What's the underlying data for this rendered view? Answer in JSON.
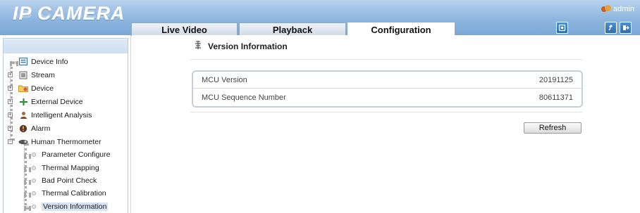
{
  "app": {
    "logo": "IP CAMERA",
    "user": "admin"
  },
  "tabs": [
    {
      "label": "Live Video",
      "active": false
    },
    {
      "label": "Playback",
      "active": false
    },
    {
      "label": "Configuration",
      "active": true
    }
  ],
  "header_icons": [
    "alarm-bell-icon",
    "change-password-icon",
    "logout-icon"
  ],
  "sidebar": {
    "items": [
      {
        "label": "Device Info",
        "icon": "device-info-icon"
      },
      {
        "label": "Stream",
        "icon": "stream-icon"
      },
      {
        "label": "Device",
        "icon": "device-folder-icon"
      },
      {
        "label": "External Device",
        "icon": "external-device-icon"
      },
      {
        "label": "Intelligent Analysis",
        "icon": "intelligent-analysis-icon"
      },
      {
        "label": "Alarm",
        "icon": "alarm-icon"
      },
      {
        "label": "Human Thermometer",
        "icon": "thermometer-icon"
      }
    ],
    "sub_items": [
      {
        "label": "Parameter Configure"
      },
      {
        "label": "Thermal Mapping"
      },
      {
        "label": "Bad Point Check"
      },
      {
        "label": "Thermal Calibration"
      },
      {
        "label": "Version Information",
        "selected": true
      }
    ]
  },
  "main": {
    "title": "Version Information",
    "rows": [
      {
        "label": "MCU Version",
        "value": "20191125"
      },
      {
        "label": "MCU Sequence Number",
        "value": "80611371"
      }
    ],
    "refresh_label": "Refresh"
  },
  "colors": {
    "header": "#8eb6df",
    "tab_border": "#8ea8c4",
    "button_blue": "#2e6cb0"
  }
}
